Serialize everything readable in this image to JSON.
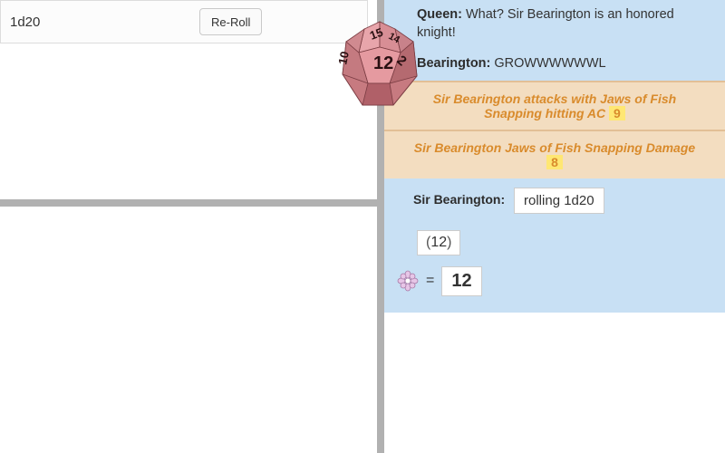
{
  "roll": {
    "input_value": "1d20",
    "reroll_label": "Re-Roll"
  },
  "chat": {
    "msg1": {
      "speaker": "Queen:",
      "text": "What? Sir Bearington is an honored knight!"
    },
    "msg2": {
      "speaker": "Bearington:",
      "text": "GROWWWWWWL"
    },
    "emote1": {
      "pre": "Sir Bearington attacks with Jaws of Fish Snapping hitting AC",
      "hl": "9"
    },
    "emote2": {
      "pre": "Sir Bearington Jaws of Fish Snapping Damage",
      "hl": "8"
    },
    "rollblock": {
      "speaker": "Sir Bearington:",
      "cmd": "rolling 1d20",
      "detail_open": "(",
      "detail_val": "12",
      "detail_close": ")",
      "eq": "=",
      "total": "12"
    }
  },
  "die": {
    "faces": {
      "a": "15",
      "b": "12",
      "c": "2",
      "d": "10",
      "e": "14"
    }
  }
}
